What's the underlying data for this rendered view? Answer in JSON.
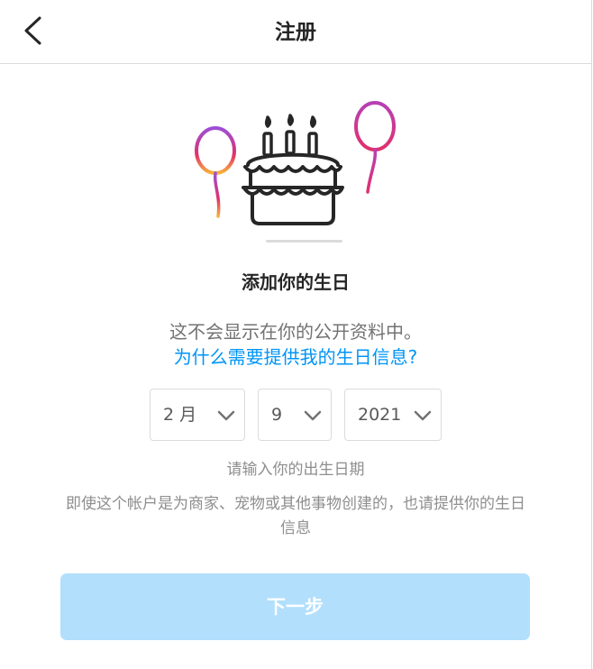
{
  "header": {
    "title": "注册",
    "back_icon": "chevron-left-icon"
  },
  "illustration": {
    "icon": "birthday-cake-icon"
  },
  "title": "添加你的生日",
  "subtitle": "这不会显示在你的公开资料中。",
  "why_link": "为什么需要提供我的生日信息?",
  "birthday": {
    "month": "2 月",
    "day": "9",
    "year": "2021"
  },
  "hint": "请输入你的出生日期",
  "note": "即使这个帐户是为商家、宠物或其他事物创建的，也请提供你的生日信息",
  "next_button": "下一步",
  "colors": {
    "link": "#0095f6",
    "button_disabled": "#b2dffc",
    "balloon_left_top": "#a14bd1",
    "balloon_left_bottom": "#f5a623",
    "balloon_right_top": "#c13584",
    "balloon_right_bottom": "#e1306c"
  }
}
